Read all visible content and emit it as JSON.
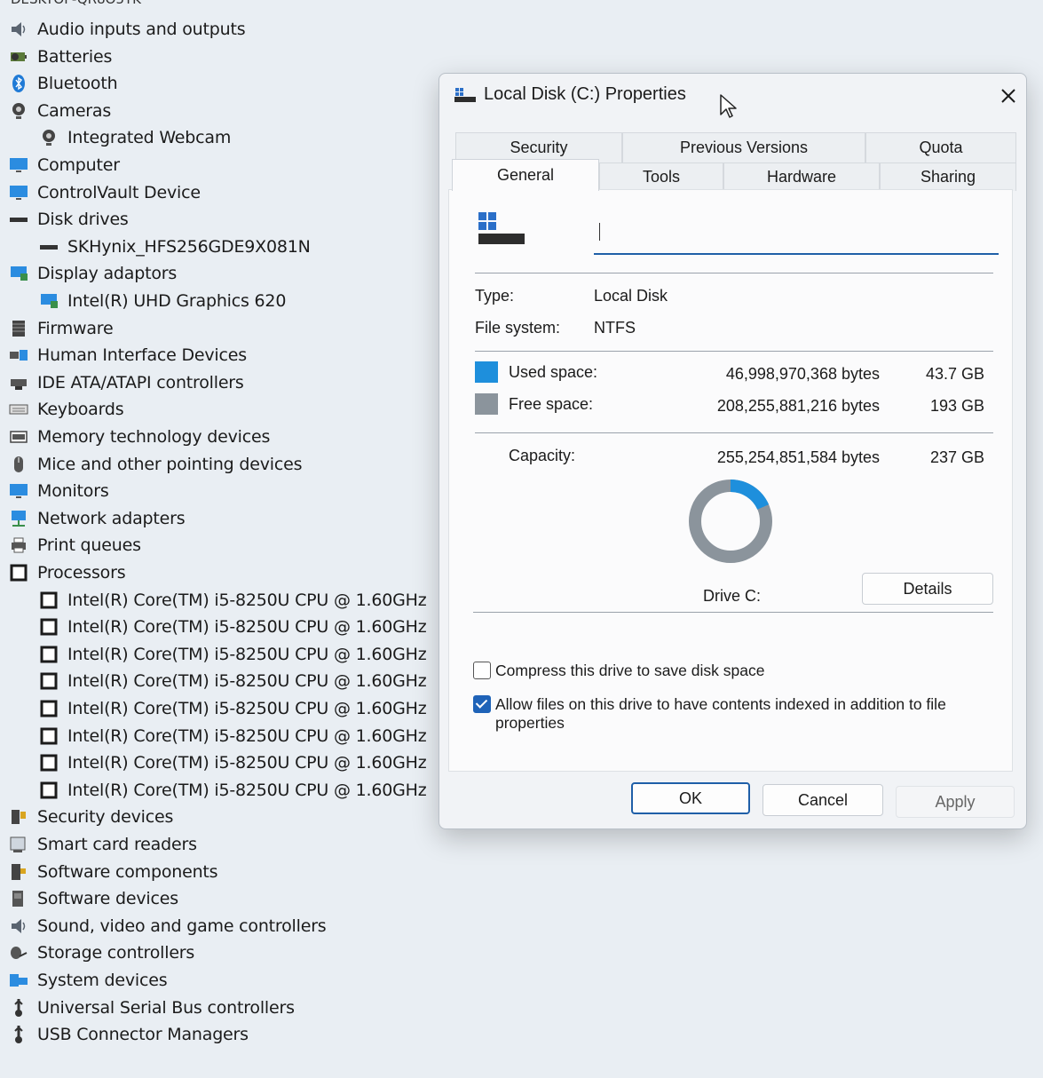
{
  "tree": {
    "root": "DESKTOP-QR8O5TK",
    "items": [
      {
        "label": "Audio inputs and outputs",
        "icon": "speaker-icon",
        "level": 0
      },
      {
        "label": "Batteries",
        "icon": "battery-icon",
        "level": 0
      },
      {
        "label": "Bluetooth",
        "icon": "bluetooth-icon",
        "level": 0
      },
      {
        "label": "Cameras",
        "icon": "camera-icon",
        "level": 0
      },
      {
        "label": "Integrated Webcam",
        "icon": "webcam-icon",
        "level": 1
      },
      {
        "label": "Computer",
        "icon": "monitor-icon",
        "level": 0
      },
      {
        "label": "ControlVault Device",
        "icon": "monitor-icon",
        "level": 0
      },
      {
        "label": "Disk drives",
        "icon": "disk-icon",
        "level": 0
      },
      {
        "label": "SKHynix_HFS256GDE9X081N",
        "icon": "disk-icon",
        "level": 1
      },
      {
        "label": "Display adaptors",
        "icon": "display-adapter-icon",
        "level": 0
      },
      {
        "label": "Intel(R) UHD Graphics 620",
        "icon": "display-adapter-icon",
        "level": 1
      },
      {
        "label": "Firmware",
        "icon": "firmware-icon",
        "level": 0
      },
      {
        "label": "Human Interface Devices",
        "icon": "hid-icon",
        "level": 0
      },
      {
        "label": "IDE ATA/ATAPI controllers",
        "icon": "ide-icon",
        "level": 0
      },
      {
        "label": "Keyboards",
        "icon": "keyboard-icon",
        "level": 0
      },
      {
        "label": "Memory technology devices",
        "icon": "memory-icon",
        "level": 0
      },
      {
        "label": "Mice and other pointing devices",
        "icon": "mouse-icon",
        "level": 0
      },
      {
        "label": "Monitors",
        "icon": "monitor-icon",
        "level": 0
      },
      {
        "label": "Network adapters",
        "icon": "network-icon",
        "level": 0
      },
      {
        "label": "Print queues",
        "icon": "printer-icon",
        "level": 0
      },
      {
        "label": "Processors",
        "icon": "processor-icon",
        "level": 0
      },
      {
        "label": "Intel(R) Core(TM) i5-8250U CPU @ 1.60GHz",
        "icon": "processor-icon",
        "level": 1
      },
      {
        "label": "Intel(R) Core(TM) i5-8250U CPU @ 1.60GHz",
        "icon": "processor-icon",
        "level": 1
      },
      {
        "label": "Intel(R) Core(TM) i5-8250U CPU @ 1.60GHz",
        "icon": "processor-icon",
        "level": 1
      },
      {
        "label": "Intel(R) Core(TM) i5-8250U CPU @ 1.60GHz",
        "icon": "processor-icon",
        "level": 1
      },
      {
        "label": "Intel(R) Core(TM) i5-8250U CPU @ 1.60GHz",
        "icon": "processor-icon",
        "level": 1
      },
      {
        "label": "Intel(R) Core(TM) i5-8250U CPU @ 1.60GHz",
        "icon": "processor-icon",
        "level": 1
      },
      {
        "label": "Intel(R) Core(TM) i5-8250U CPU @ 1.60GHz",
        "icon": "processor-icon",
        "level": 1
      },
      {
        "label": "Intel(R) Core(TM) i5-8250U CPU @ 1.60GHz",
        "icon": "processor-icon",
        "level": 1
      },
      {
        "label": "Security devices",
        "icon": "security-icon",
        "level": 0
      },
      {
        "label": "Smart card readers",
        "icon": "smartcard-icon",
        "level": 0
      },
      {
        "label": "Software components",
        "icon": "software-component-icon",
        "level": 0
      },
      {
        "label": "Software devices",
        "icon": "software-device-icon",
        "level": 0
      },
      {
        "label": "Sound, video and game controllers",
        "icon": "speaker-icon",
        "level": 0
      },
      {
        "label": "Storage controllers",
        "icon": "storage-icon",
        "level": 0
      },
      {
        "label": "System devices",
        "icon": "system-icon",
        "level": 0
      },
      {
        "label": "Universal Serial Bus controllers",
        "icon": "usb-icon",
        "level": 0
      },
      {
        "label": "USB Connector Managers",
        "icon": "usb-icon",
        "level": 0
      }
    ]
  },
  "dialog": {
    "title": "Local Disk (C:) Properties",
    "tabs_top": [
      "Security",
      "Previous Versions",
      "Quota"
    ],
    "tabs_bottom": [
      "General",
      "Tools",
      "Hardware",
      "Sharing"
    ],
    "active_tab": "General",
    "name_value": "",
    "type_label": "Type:",
    "type_value": "Local Disk",
    "fs_label": "File system:",
    "fs_value": "NTFS",
    "used_label": "Used space:",
    "used_bytes": "46,998,970,368 bytes",
    "used_gb": "43.7 GB",
    "free_label": "Free space:",
    "free_bytes": "208,255,881,216 bytes",
    "free_gb": "193 GB",
    "capacity_label": "Capacity:",
    "capacity_bytes": "255,254,851,584 bytes",
    "capacity_gb": "237 GB",
    "drive_label": "Drive C:",
    "details_button": "Details",
    "compress_label": "Compress this drive to save disk space",
    "compress_checked": false,
    "index_label": "Allow files on this drive to have contents indexed in addition to file properties",
    "index_checked": true,
    "ok_button": "OK",
    "cancel_button": "Cancel",
    "apply_button": "Apply",
    "used_fraction": 0.184,
    "colors": {
      "used": "#1e8fdc",
      "free": "#8b949c",
      "accent": "#1f5fa8"
    }
  }
}
